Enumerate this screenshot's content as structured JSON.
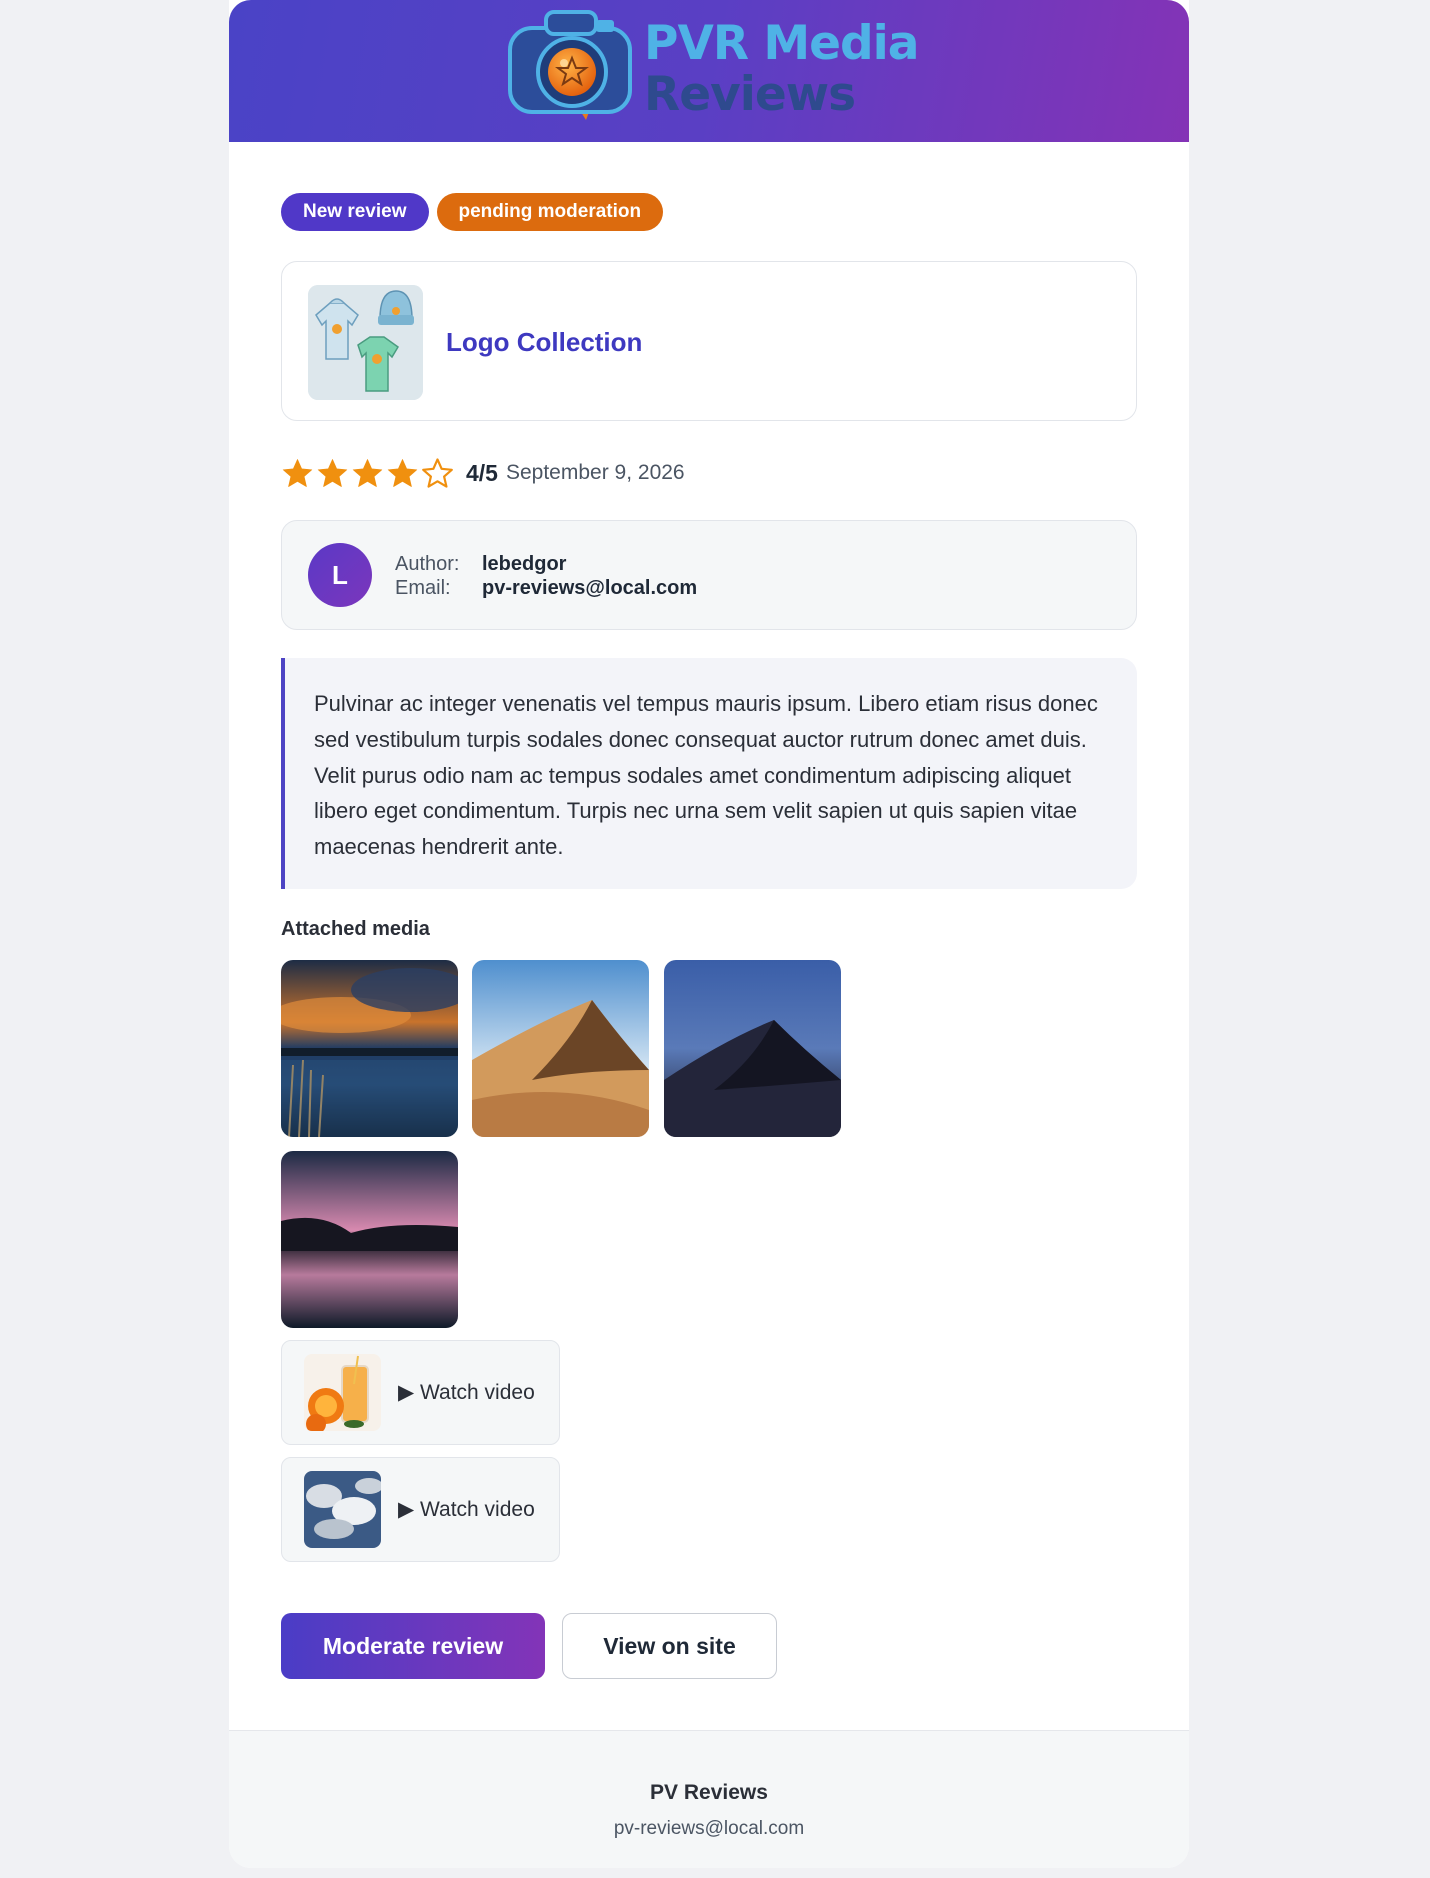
{
  "header": {
    "logo_line1": "PVR Media",
    "logo_line2": "Reviews"
  },
  "badges": {
    "new": "New review",
    "status": "pending moderation"
  },
  "product": {
    "title": "Logo Collection"
  },
  "rating": {
    "value": 4,
    "max": 5,
    "score_text": "4/5",
    "date": "September 9, 2026"
  },
  "author": {
    "initial": "L",
    "author_label": "Author:",
    "author_value": "lebedgor",
    "email_label": "Email:",
    "email_value": "pv-reviews@local.com"
  },
  "review": {
    "text": "Pulvinar ac integer venenatis vel tempus mauris ipsum. Libero etiam risus donec sed vestibulum turpis sodales donec consequat auctor rutrum donec amet duis. Velit purus odio nam ac tempus sodales amet condimentum adipiscing aliquet libero eget condimentum. Turpis nec urna sem velit sapien ut quis sapien vitae maecenas hendrerit ante."
  },
  "media": {
    "title": "Attached media",
    "videos": [
      {
        "label": "▶ Watch video"
      },
      {
        "label": "▶ Watch video"
      }
    ]
  },
  "actions": {
    "moderate": "Moderate review",
    "view": "View on site"
  },
  "footer": {
    "name": "PV Reviews",
    "email": "pv-reviews@local.com"
  },
  "colors": {
    "accent": "#4a43c6",
    "status": "#dc6b0e",
    "star": "#f0900f"
  }
}
